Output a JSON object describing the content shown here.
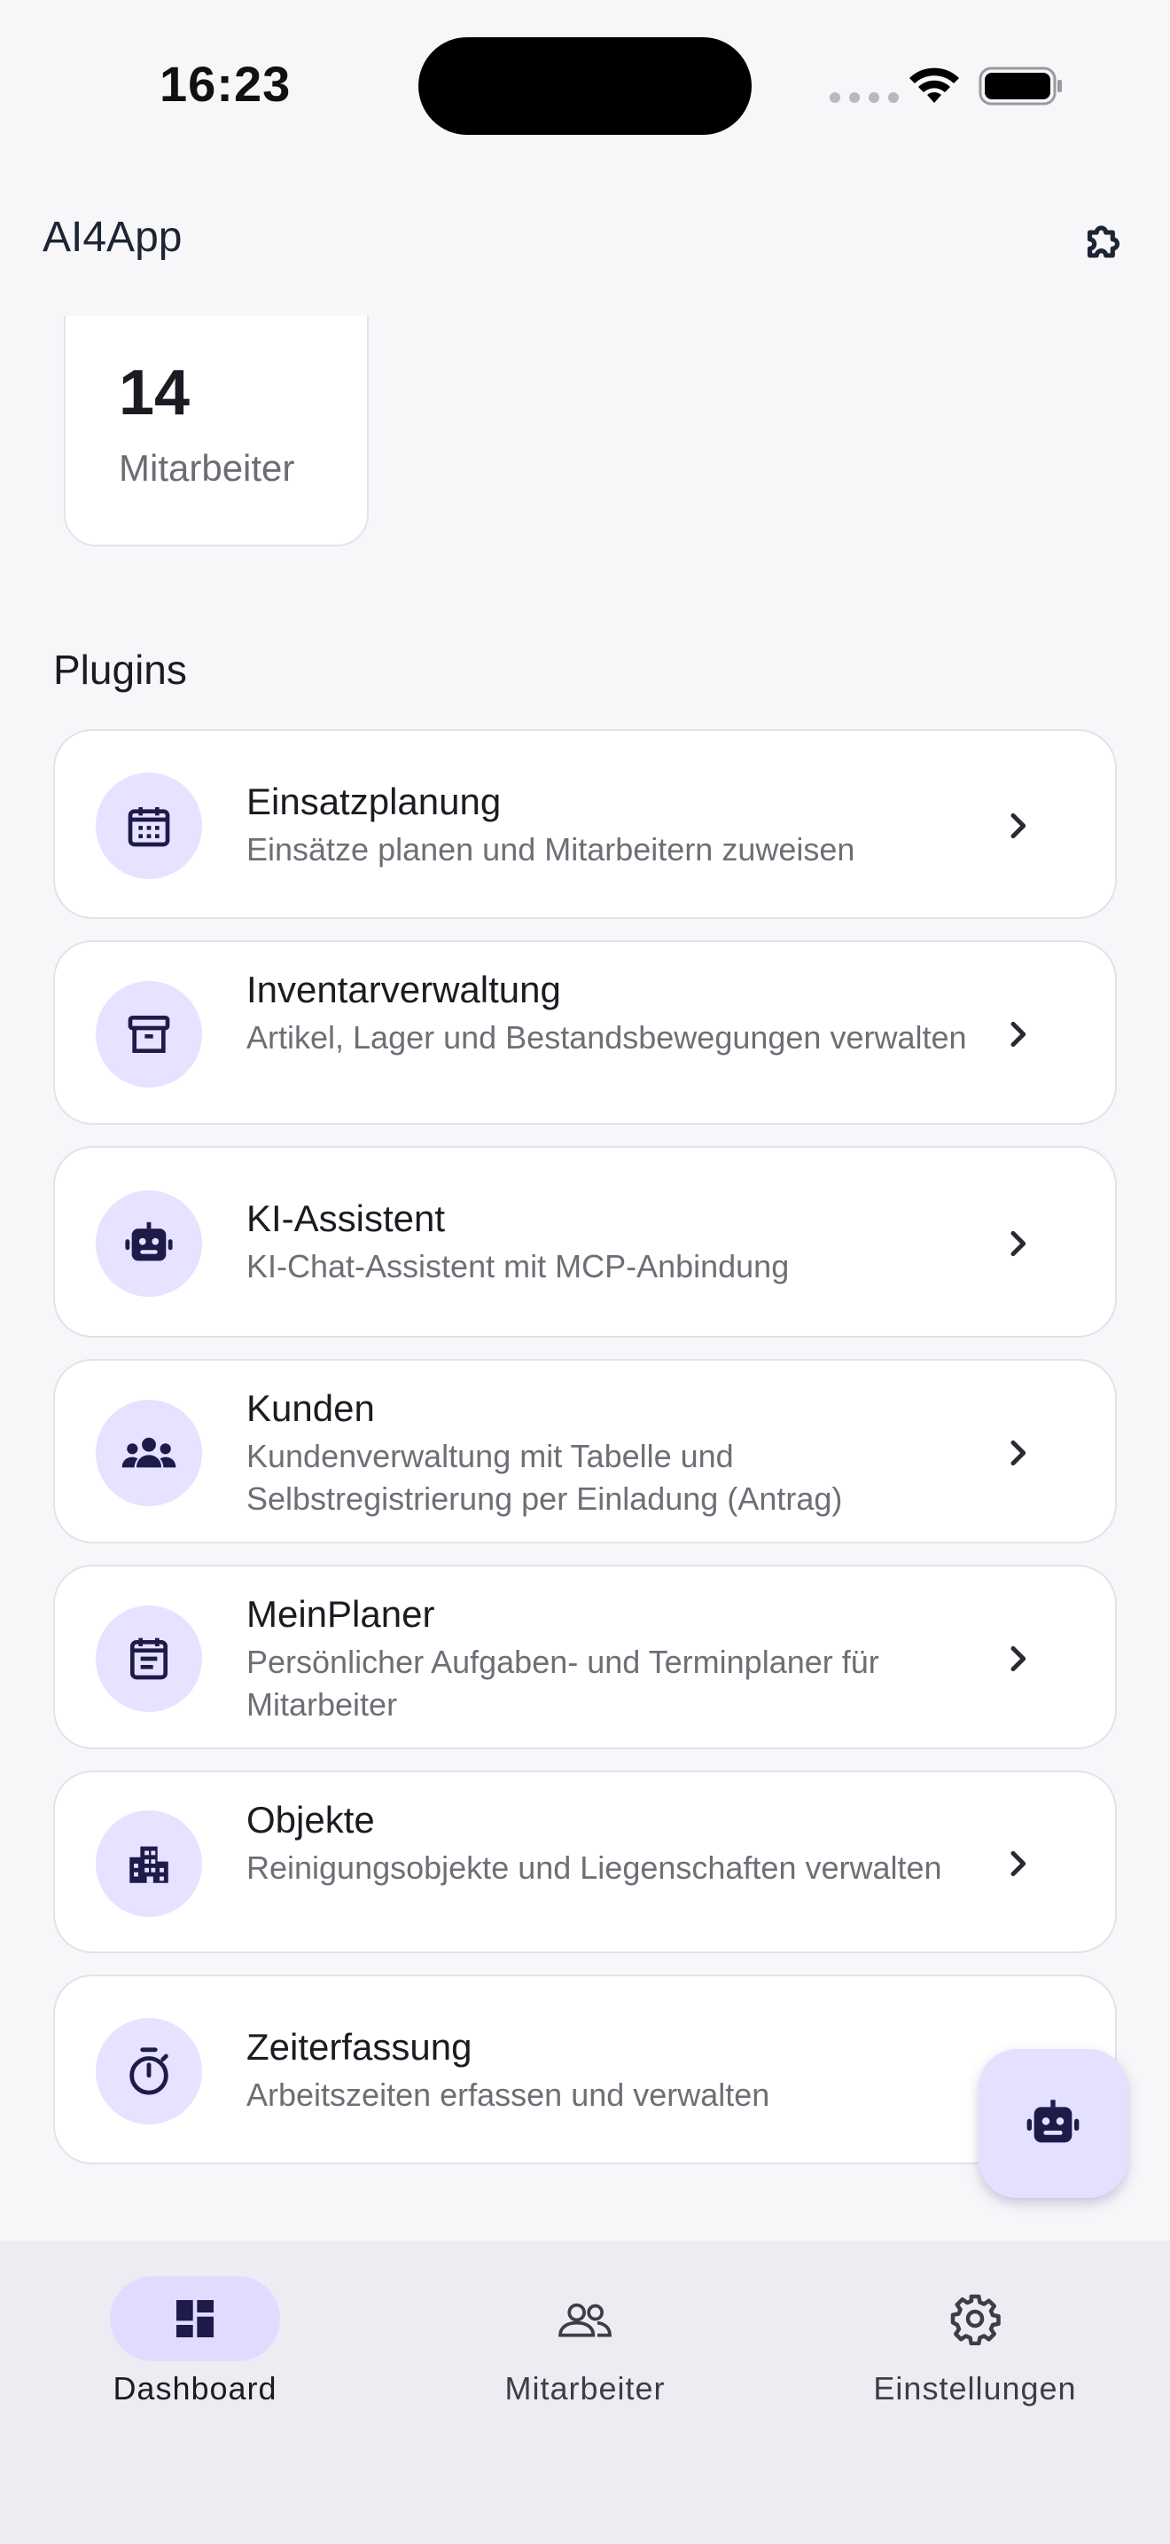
{
  "status_bar": {
    "time": "16:23"
  },
  "app_bar": {
    "title": "AI4App",
    "action_icon": "puzzle-icon"
  },
  "stats": {
    "value": "14",
    "label": "Mitarbeiter"
  },
  "plugins": {
    "section_title": "Plugins",
    "items": [
      {
        "title": "Einsatzplanung",
        "description": "Einsätze planen und Mitarbeitern zuweisen",
        "icon": "calendar-icon"
      },
      {
        "title": "Inventarverwaltung",
        "description": "Artikel, Lager und Bestandsbewegungen verwalten",
        "icon": "archive-box-icon"
      },
      {
        "title": "KI-Assistent",
        "description": "KI-Chat-Assistent mit MCP-Anbindung",
        "icon": "robot-icon"
      },
      {
        "title": "Kunden",
        "description": "Kundenverwaltung mit Tabelle und Selbstregistrierung per Einladung (Antrag)",
        "icon": "people-group-icon"
      },
      {
        "title": "MeinPlaner",
        "description": "Persönlicher Aufgaben- und Terminplaner für Mitarbeiter",
        "icon": "planner-icon"
      },
      {
        "title": "Objekte",
        "description": "Reinigungsobjekte und Liegenschaften verwalten",
        "icon": "building-icon"
      },
      {
        "title": "Zeiterfassung",
        "description": "Arbeitszeiten erfassen und verwalten",
        "icon": "stopwatch-icon"
      }
    ]
  },
  "bottom_nav": {
    "items": [
      {
        "label": "Dashboard",
        "icon": "dashboard-icon",
        "active": true
      },
      {
        "label": "Mitarbeiter",
        "icon": "people-icon",
        "active": false
      },
      {
        "label": "Einstellungen",
        "icon": "gear-icon",
        "active": false
      }
    ]
  },
  "colors": {
    "accent": "#e6e2ff",
    "icon": "#1e1b4b",
    "background": "#f7f7fa"
  }
}
